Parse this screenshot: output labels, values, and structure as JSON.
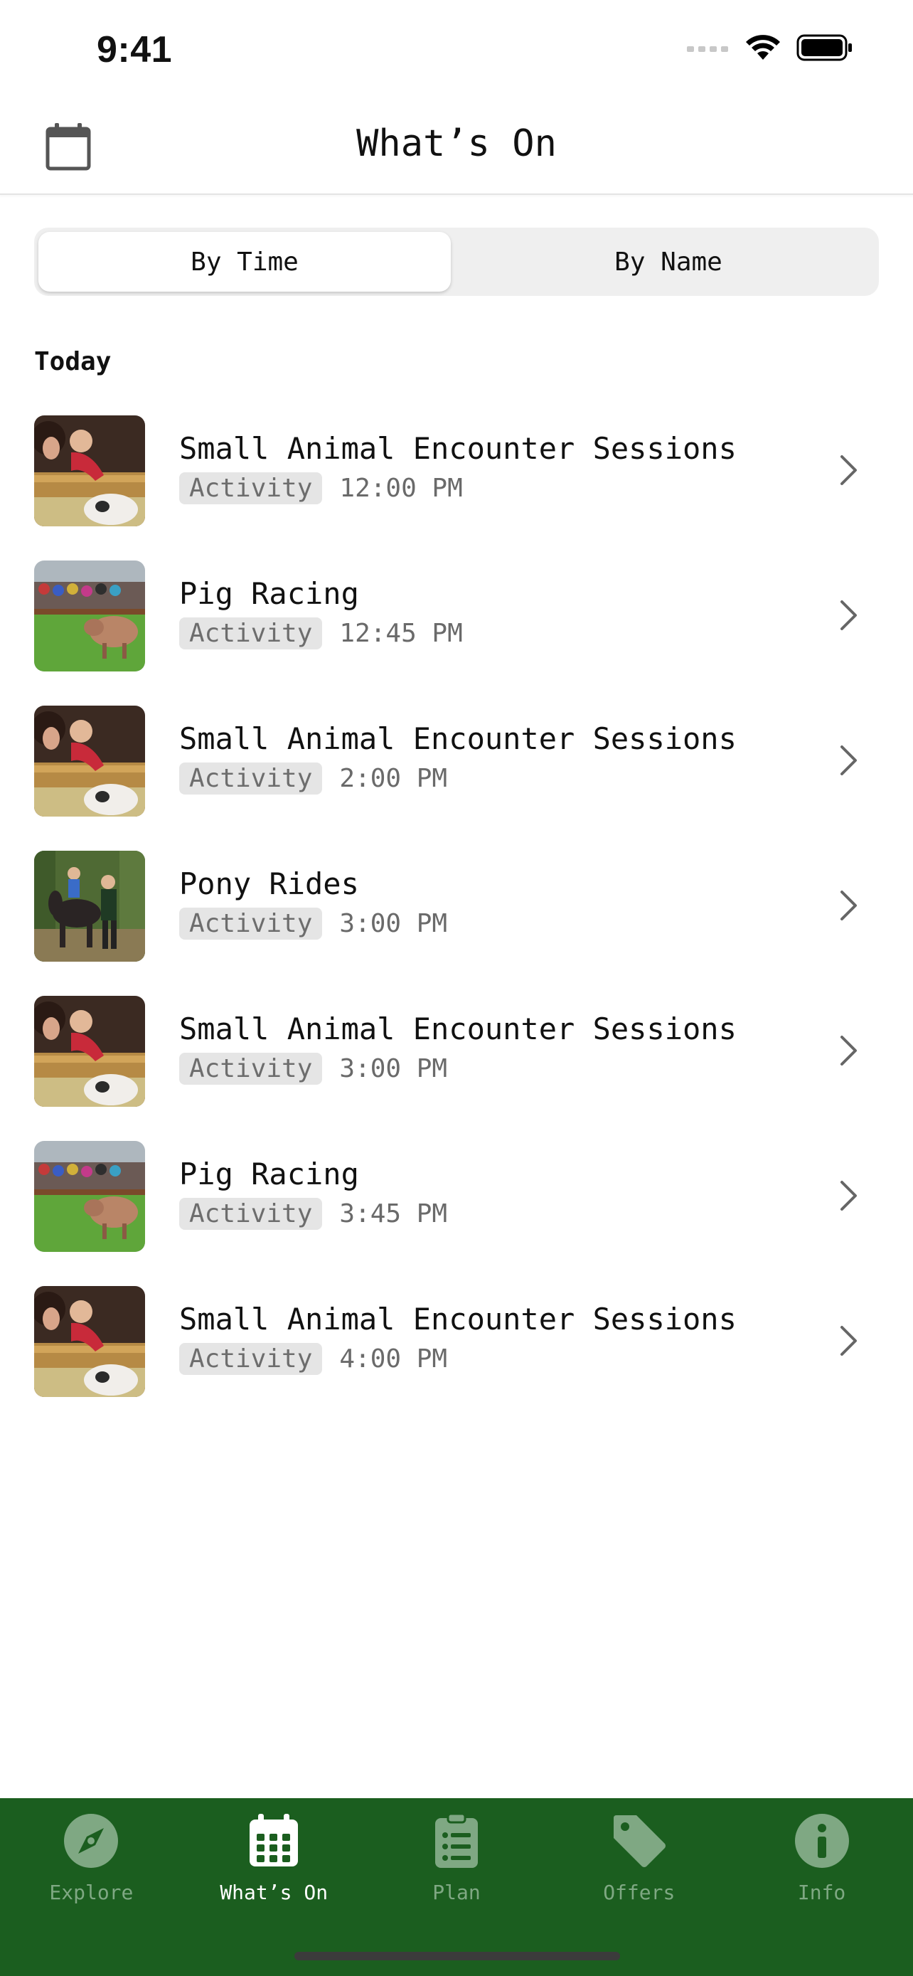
{
  "status_bar": {
    "time": "9:41"
  },
  "header": {
    "title": "What’s On",
    "calendar_icon": "calendar-icon"
  },
  "segmented": {
    "options": [
      "By Time",
      "By Name"
    ],
    "selected": "By Time"
  },
  "section": {
    "title": "Today"
  },
  "events": [
    {
      "title": "Small Animal Encounter Sessions",
      "type": "Activity",
      "time": "12:00 PM",
      "image": "small-animal"
    },
    {
      "title": "Pig Racing",
      "type": "Activity",
      "time": "12:45 PM",
      "image": "pig-racing"
    },
    {
      "title": "Small Animal Encounter Sessions",
      "type": "Activity",
      "time": "2:00 PM",
      "image": "small-animal"
    },
    {
      "title": "Pony Rides",
      "type": "Activity",
      "time": "3:00 PM",
      "image": "pony-rides"
    },
    {
      "title": "Small Animal Encounter Sessions",
      "type": "Activity",
      "time": "3:00 PM",
      "image": "small-animal"
    },
    {
      "title": "Pig Racing",
      "type": "Activity",
      "time": "3:45 PM",
      "image": "pig-racing"
    },
    {
      "title": "Small Animal Encounter Sessions",
      "type": "Activity",
      "time": "4:00 PM",
      "image": "small-animal"
    }
  ],
  "tab_bar": {
    "tabs": [
      {
        "label": "Explore",
        "icon": "compass-icon"
      },
      {
        "label": "What’s On",
        "icon": "calendar-grid-icon"
      },
      {
        "label": "Plan",
        "icon": "clipboard-list-icon"
      },
      {
        "label": "Offers",
        "icon": "tag-icon"
      },
      {
        "label": "Info",
        "icon": "info-icon"
      }
    ],
    "selected": "What’s On"
  },
  "colors": {
    "tab_bar_bg": "#1b5e1f",
    "tab_inactive": "#7fa883",
    "tab_active": "#ffffff",
    "badge_bg": "#e5e5e5"
  }
}
